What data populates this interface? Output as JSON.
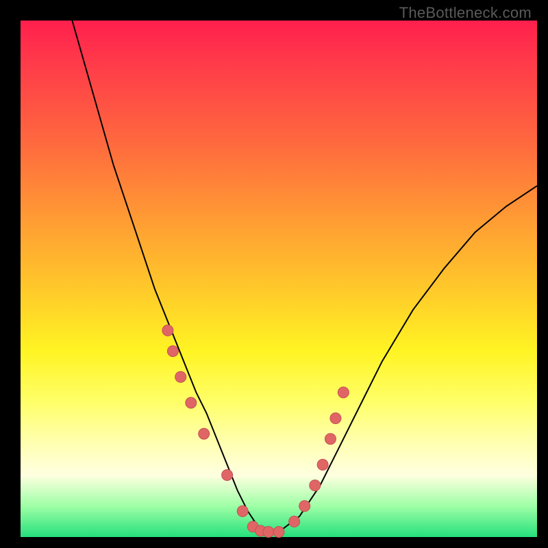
{
  "attribution": "TheBottleneck.com",
  "chart_data": {
    "type": "line",
    "title": "",
    "xlabel": "",
    "ylabel": "",
    "xlim": [
      0,
      100
    ],
    "ylim": [
      0,
      100
    ],
    "series": [
      {
        "name": "curve",
        "x": [
          10,
          14,
          18,
          22,
          26,
          28,
          30,
          32,
          34,
          36,
          38,
          40,
          42,
          44,
          46,
          48,
          50,
          54,
          58,
          62,
          66,
          70,
          76,
          82,
          88,
          94,
          100
        ],
        "values": [
          100,
          86,
          72,
          60,
          48,
          43,
          38,
          33,
          28,
          24,
          19,
          14,
          9,
          5,
          2,
          1,
          1,
          4,
          10,
          18,
          26,
          34,
          44,
          52,
          59,
          64,
          68
        ]
      }
    ],
    "markers": {
      "name": "highlighted-points",
      "x": [
        28.5,
        29.5,
        31,
        33,
        35.5,
        40,
        43,
        45,
        46.5,
        48,
        50,
        53,
        55,
        57,
        58.5,
        60,
        61,
        62.5
      ],
      "values": [
        40,
        36,
        31,
        26,
        20,
        12,
        5,
        2,
        1.2,
        1,
        1,
        3,
        6,
        10,
        14,
        19,
        23,
        28
      ]
    },
    "background_gradient": {
      "top": "#ff1f4d",
      "mid": "#fff423",
      "bottom": "#25e07c"
    }
  }
}
